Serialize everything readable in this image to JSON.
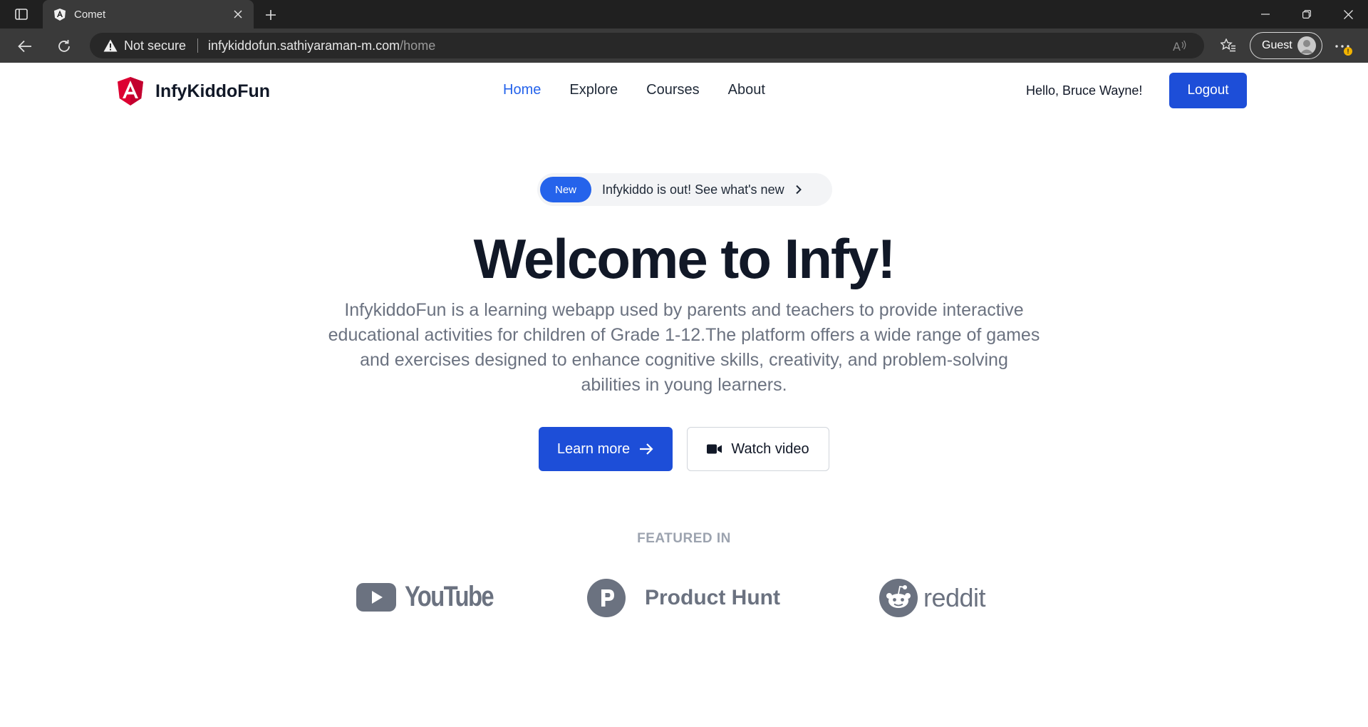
{
  "browser": {
    "tab_title": "Comet",
    "security_label": "Not secure",
    "url_host": "infykiddofun.sathiyaraman-m.com",
    "url_path": "/home",
    "profile_label": "Guest",
    "icons": [
      "sidebar-icon",
      "angular-favicon-icon",
      "close-icon",
      "plus-icon",
      "minimize-icon",
      "restore-icon",
      "close-window-icon",
      "back-arrow-icon",
      "refresh-icon",
      "warning-icon",
      "read-aloud-icon",
      "favorites-icon",
      "avatar-icon",
      "more-icon"
    ]
  },
  "header": {
    "brand_name": "InfyKiddoFun",
    "nav": [
      {
        "label": "Home",
        "active": true
      },
      {
        "label": "Explore",
        "active": false
      },
      {
        "label": "Courses",
        "active": false
      },
      {
        "label": "About",
        "active": false
      }
    ],
    "greeting": "Hello, Bruce Wayne!",
    "logout_label": "Logout"
  },
  "hero": {
    "badge_label": "New",
    "announcement": "Infykiddo is out! See what's new",
    "title": "Welcome to Infy!",
    "description": "InfykiddoFun is a learning webapp used by parents and teachers to provide interactive educational activities for children of Grade 1-12.The platform offers a wide range of games and exercises designed to enhance cognitive skills, creativity, and problem-solving abilities in young learners.",
    "primary_cta": "Learn more",
    "secondary_cta": "Watch video"
  },
  "featured": {
    "label": "FEATURED IN",
    "logos": [
      {
        "name": "YouTube",
        "icon": "youtube-icon"
      },
      {
        "name": "Product Hunt",
        "icon": "product-hunt-icon"
      },
      {
        "name": "reddit",
        "icon": "reddit-icon"
      }
    ]
  },
  "colors": {
    "primary": "#1d4ed8",
    "nav_active": "#2563eb",
    "brand_logo": "#dd0031",
    "muted_text": "#6b7280",
    "logo_gray": "#6b7280"
  }
}
